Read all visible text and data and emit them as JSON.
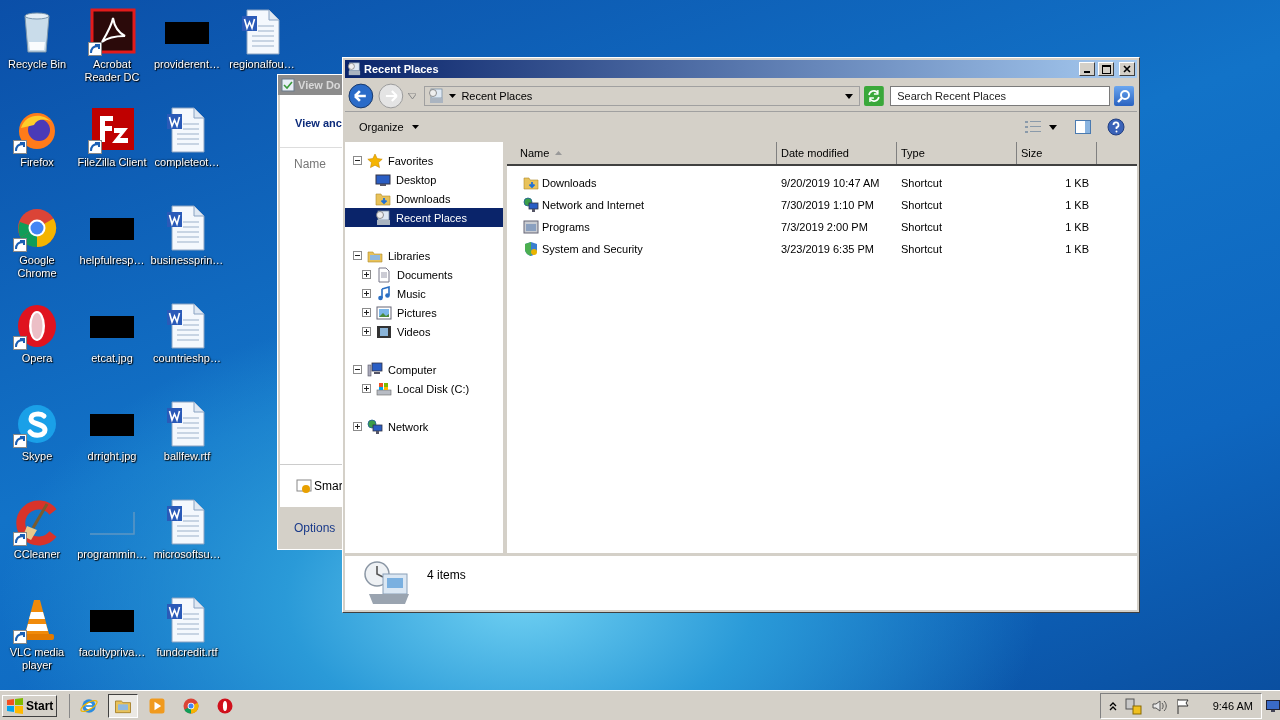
{
  "desktop_icons": [
    {
      "label": "Recycle Bin",
      "kind": "recycle-bin",
      "shortcut": false
    },
    {
      "label": "Firefox",
      "kind": "firefox",
      "shortcut": true
    },
    {
      "label": "Google Chrome",
      "kind": "chrome",
      "shortcut": true
    },
    {
      "label": "Opera",
      "kind": "opera",
      "shortcut": true
    },
    {
      "label": "Skype",
      "kind": "skype",
      "shortcut": true
    },
    {
      "label": "CCleaner",
      "kind": "ccleaner",
      "shortcut": true
    },
    {
      "label": "VLC media player",
      "kind": "vlc",
      "shortcut": true
    },
    {
      "label": "Acrobat Reader DC",
      "kind": "acrobat",
      "shortcut": true
    },
    {
      "label": "FileZilla Client",
      "kind": "filezilla",
      "shortcut": true
    },
    {
      "label": "helpfulresp…",
      "kind": "dark-thumbnail",
      "shortcut": false
    },
    {
      "label": "etcat.jpg",
      "kind": "dark-thumbnail",
      "shortcut": false
    },
    {
      "label": "drright.jpg",
      "kind": "dark-thumbnail",
      "shortcut": false
    },
    {
      "label": "programmin…",
      "kind": "blank-thumbnail",
      "shortcut": false
    },
    {
      "label": "facultypriva…",
      "kind": "dark-thumbnail",
      "shortcut": false
    },
    {
      "label": "providerent…",
      "kind": "dark-thumbnail",
      "shortcut": false
    },
    {
      "label": "completeot…",
      "kind": "word",
      "shortcut": false
    },
    {
      "label": "businessprin…",
      "kind": "word",
      "shortcut": false
    },
    {
      "label": "countrieshp…",
      "kind": "word",
      "shortcut": false
    },
    {
      "label": "ballfew.rtf",
      "kind": "word",
      "shortcut": false
    },
    {
      "label": "microsoftsu…",
      "kind": "word",
      "shortcut": false
    },
    {
      "label": "fundcredit.rtf",
      "kind": "word",
      "shortcut": false
    },
    {
      "label": "regionalfou…",
      "kind": "word",
      "shortcut": false
    }
  ],
  "background_window": {
    "title": "View Do",
    "heading": "View anc",
    "column": "Name",
    "item": "Smar",
    "link": "Options"
  },
  "explorer": {
    "title": "Recent Places",
    "address": "Recent Places",
    "search": {
      "placeholder": "Search Recent Places"
    },
    "organize": "Organize",
    "navigation": [
      {
        "label": "Favorites",
        "kind": "star",
        "expanded": true,
        "selected": false,
        "children": [
          {
            "label": "Desktop",
            "kind": "desktop",
            "selected": false
          },
          {
            "label": "Downloads",
            "kind": "downloads",
            "selected": false
          },
          {
            "label": "Recent Places",
            "kind": "recent",
            "selected": true
          }
        ]
      },
      {
        "label": "Libraries",
        "kind": "libraries",
        "expanded": true,
        "selected": false,
        "children": [
          {
            "label": "Documents",
            "kind": "documents",
            "expanded": false,
            "selected": false
          },
          {
            "label": "Music",
            "kind": "music",
            "expanded": false,
            "selected": false
          },
          {
            "label": "Pictures",
            "kind": "pictures",
            "expanded": false,
            "selected": false
          },
          {
            "label": "Videos",
            "kind": "videos",
            "expanded": false,
            "selected": false
          }
        ]
      },
      {
        "label": "Computer",
        "kind": "computer",
        "expanded": true,
        "selected": false,
        "children": [
          {
            "label": "Local Disk (C:)",
            "kind": "disk",
            "expanded": false,
            "selected": false
          }
        ]
      },
      {
        "label": "Network",
        "kind": "network",
        "expanded": false,
        "selected": false
      }
    ],
    "columns": [
      {
        "label": "Name",
        "sorted": true
      },
      {
        "label": "Date modified",
        "sorted": false
      },
      {
        "label": "Type",
        "sorted": false
      },
      {
        "label": "Size",
        "sorted": false
      }
    ],
    "rows": [
      {
        "name": "Downloads",
        "kind": "downloads",
        "date": "9/20/2019 10:47 AM",
        "type": "Shortcut",
        "size": "1 KB"
      },
      {
        "name": "Network and Internet",
        "kind": "network",
        "date": "7/30/2019 1:10 PM",
        "type": "Shortcut",
        "size": "1 KB"
      },
      {
        "name": "Programs",
        "kind": "programs",
        "date": "7/3/2019 2:00 PM",
        "type": "Shortcut",
        "size": "1 KB"
      },
      {
        "name": "System and Security",
        "kind": "shield",
        "date": "3/23/2019 6:35 PM",
        "type": "Shortcut",
        "size": "1 KB"
      }
    ],
    "status": "4 items"
  },
  "taskbar": {
    "start": "Start",
    "apps": [
      {
        "kind": "ie",
        "selected": false
      },
      {
        "kind": "explorer",
        "selected": true
      },
      {
        "kind": "media-player",
        "selected": false
      },
      {
        "kind": "chrome",
        "selected": false
      },
      {
        "kind": "opera",
        "selected": false
      }
    ],
    "clock": "9:46 AM"
  }
}
